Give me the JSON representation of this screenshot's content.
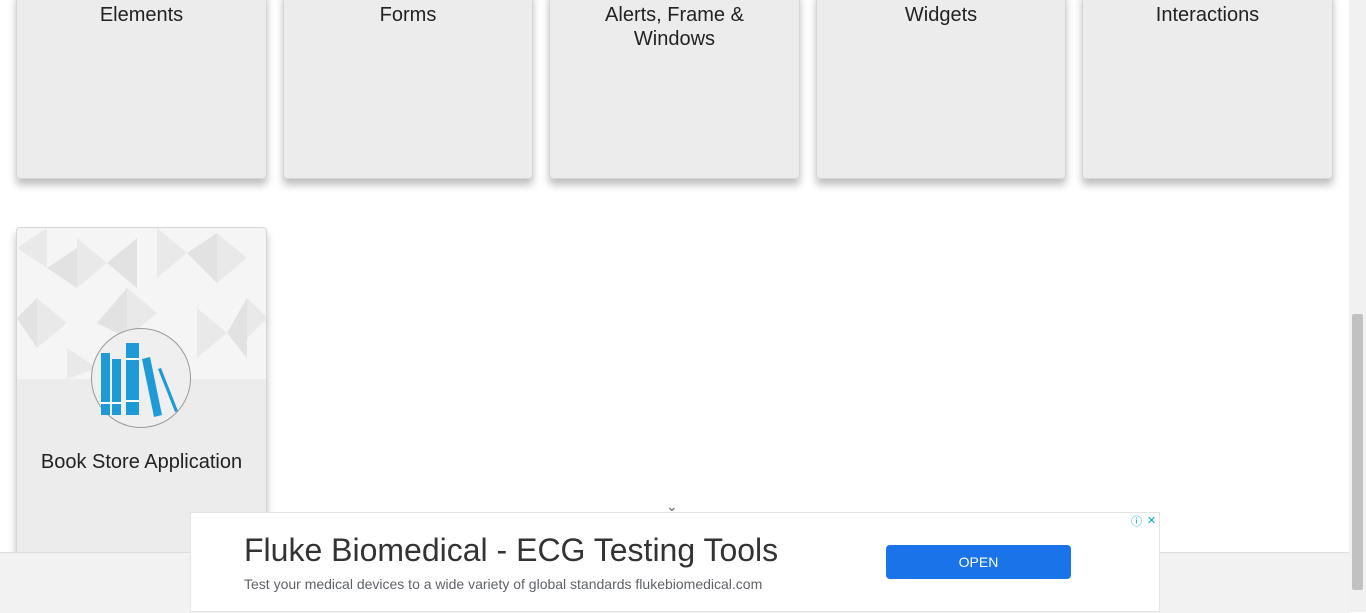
{
  "cards": [
    {
      "title": "Elements"
    },
    {
      "title": "Forms"
    },
    {
      "title": "Alerts, Frame & Windows"
    },
    {
      "title": "Widgets"
    },
    {
      "title": "Interactions"
    }
  ],
  "book_card": {
    "title": "Book Store Application",
    "icon": "book-shelf-icon"
  },
  "ad": {
    "title": "Fluke Biomedical - ECG Testing Tools",
    "description": "Test your medical devices to a wide variety of global standards flukebiomedical.com",
    "button_label": "OPEN",
    "info_icon": "ⓘ",
    "close_icon": "✕"
  },
  "chevron": "⌄",
  "colors": {
    "accent": "#1a73e8",
    "book_icon": "#1e9ad6"
  }
}
